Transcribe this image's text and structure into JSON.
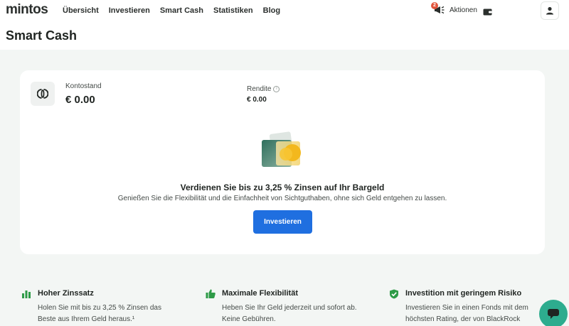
{
  "brand": {
    "logo": "mintos"
  },
  "nav": {
    "items": [
      {
        "label": "Übersicht"
      },
      {
        "label": "Investieren"
      },
      {
        "label": "Smart Cash"
      },
      {
        "label": "Statistiken"
      },
      {
        "label": "Blog"
      }
    ],
    "aktionen_label": "Aktionen",
    "aktionen_count": "2"
  },
  "page": {
    "title": "Smart Cash"
  },
  "card": {
    "kontostand_label": "Kontostand",
    "kontostand_value": "€ 0.00",
    "rendite_label": "Rendite",
    "rendite_value": "€ 0.00",
    "headline": "Verdienen Sie bis zu 3,25 % Zinsen auf Ihr Bargeld",
    "subline": "Genießen Sie die Flexibilität und die Einfachheit von Sichtguthaben, ohne sich Geld entgehen zu lassen.",
    "cta_label": "Investieren"
  },
  "features": [
    {
      "title": "Hoher Zinssatz",
      "desc": "Holen Sie mit bis zu 3,25 % Zinsen das Beste aus Ihrem Geld heraus.¹"
    },
    {
      "title": "Maximale Flexibilität",
      "desc": "Heben Sie Ihr Geld jederzeit und sofort ab. Keine Gebühren."
    },
    {
      "title": "Investition mit geringem Risiko",
      "desc": "Investieren Sie in einen Fonds mit dem höchsten Rating, der von BlackRock"
    }
  ],
  "colors": {
    "accent_blue": "#1f6fe0",
    "feature_green": "#2e9b47",
    "chat_teal": "#2dac8e",
    "badge_red": "#e2553c",
    "coin_yellow": "#f3b81d"
  },
  "icons": {
    "notification": "bell-icon",
    "wallet": "wallet-icon",
    "user": "user-icon",
    "account": "smart-cash-icon",
    "info": "info-icon",
    "feature_1": "bar-chart-icon",
    "feature_2": "thumbs-up-icon",
    "feature_3": "shield-check-icon",
    "chat": "chat-icon"
  }
}
